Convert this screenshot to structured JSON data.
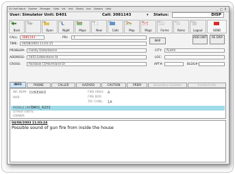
{
  "menu": [
    "Sy UseOutput",
    "System",
    "Manager",
    "Goto",
    "Ids",
    "Unit",
    "Status",
    "Inst",
    "Options",
    "Help"
  ],
  "window_controls": [
    "_",
    "□",
    "X"
  ],
  "status_bar": {
    "user": "User: Simulator Unit: D401",
    "call": "Call: 3081143",
    "status_label": "Status:",
    "status_value": "DISP"
  },
  "toolbar": [
    {
      "key": "F1",
      "label": "Back"
    },
    {
      "key": "F2",
      "label": ""
    },
    {
      "key": "F3",
      "label": "Open"
    },
    {
      "key": "F4",
      "label": "Night"
    },
    {
      "key": "F5",
      "label": "Maps"
    },
    {
      "key": "F6",
      "label": "New"
    },
    {
      "key": "F7",
      "label": "Calls"
    },
    {
      "key": "F8",
      "label": "Map"
    },
    {
      "key": "F9",
      "label": "Msgs"
    },
    {
      "key": "F10",
      "label": "Forms"
    },
    {
      "key": "F11",
      "label": "Rems"
    },
    {
      "key": "F12",
      "label": "Logout"
    },
    {
      "key": "",
      "label": "SEND"
    }
  ],
  "call": {
    "call_label": "CALL:",
    "call_value": "3081143",
    "pri_label": "PRI:",
    "pri_value": "1",
    "time_label": "TIME:",
    "time_value": "04/08/2003 11:01:25",
    "problem_label": "PROBLEM:",
    "problem_value": "Family Disturbance",
    "city_label": "CITY:",
    "city_value": "Austin",
    "address_label": "ADDRESS:",
    "address_value": "5455 Edderstone St",
    "loc_label": "LOC:",
    "cross_label": "CROSS:",
    "cross_value": "Rainbow Ct/Harmland Dr",
    "apt_label": "APT#:",
    "bldg_label": "BLDG#:"
  },
  "buttons": {
    "map": "MAP",
    "add_unit": "ADD UNIT",
    "re_disp": "RE DISP"
  },
  "tabs": [
    "INFO",
    "PHONE",
    "CALLER",
    "HAZARD",
    "CAUTION",
    "PREM",
    "Secondary Location",
    "Incident Info"
  ],
  "info_panel": {
    "incident_label": "INC NUM:",
    "incident_value": "D/WEARD",
    "map_label": "MAP:",
    "fire_area_label": "FIRE AREA:",
    "fire_area_value": "A",
    "fire_box_label": "FIRE BOX:",
    "tac_label": "TAC CHNL:",
    "tac_value": "1A",
    "units_label": "MOBILE UNITS:",
    "units_value": "D401_A201",
    "other_label": "OTHER UNITS:",
    "owner_label": "OWNER:"
  },
  "notes": {
    "timestamp": "04/08/2003 11:03:24",
    "text": "Possible sound of gun fire from inside the house"
  },
  "colors": {
    "accent_tab": "#cfe7ff",
    "highlight_row": "#9fdbe8",
    "call_red": "#cc0000"
  }
}
